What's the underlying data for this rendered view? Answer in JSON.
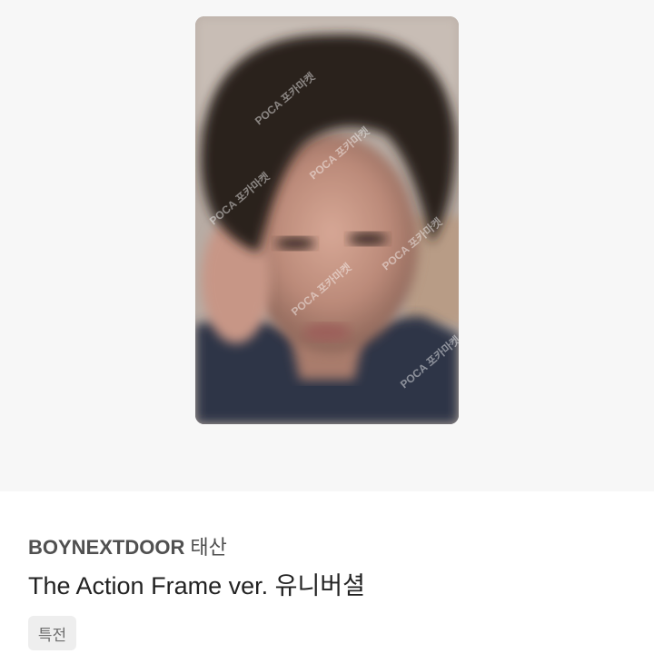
{
  "product": {
    "artist": "BOYNEXTDOOR",
    "member": "태산",
    "title": "The Action Frame ver. 유니버셜",
    "tag": "특전"
  },
  "photo": {
    "icon": "photocard-image",
    "watermark_text": "POCA 포카마켓"
  },
  "colors": {
    "background": "#f7f7f7",
    "tag_background": "#eeeeee"
  }
}
